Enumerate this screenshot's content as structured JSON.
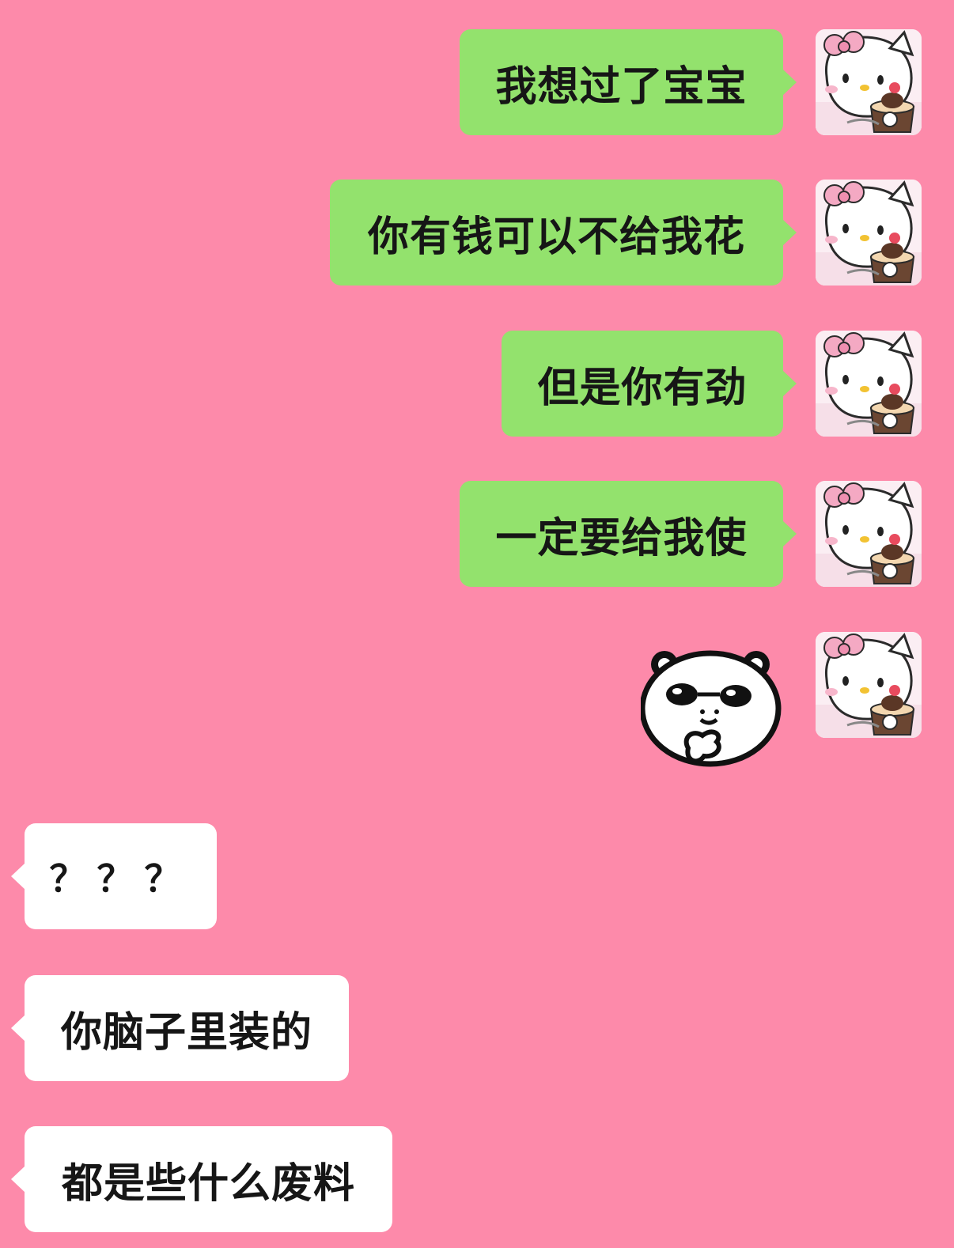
{
  "colors": {
    "background": "#fd8aaa",
    "sent_bubble": "#93e26d",
    "received_bubble": "#ffffff",
    "text": "#161616"
  },
  "messages": [
    {
      "side": "sent",
      "text": "我想过了宝宝",
      "avatar": "hello-kitty-avatar"
    },
    {
      "side": "sent",
      "text": "你有钱可以不给我花",
      "avatar": "hello-kitty-avatar"
    },
    {
      "side": "sent",
      "text": "但是你有劲",
      "avatar": "hello-kitty-avatar"
    },
    {
      "side": "sent",
      "text": "一定要给我使",
      "avatar": "hello-kitty-avatar"
    },
    {
      "side": "sent",
      "sticker": "panda-sunglasses-sticker",
      "avatar": "hello-kitty-avatar"
    },
    {
      "side": "received",
      "text": "？？？"
    },
    {
      "side": "received",
      "text": "你脑子里装的"
    },
    {
      "side": "received",
      "text": "都是些什么废料"
    }
  ]
}
